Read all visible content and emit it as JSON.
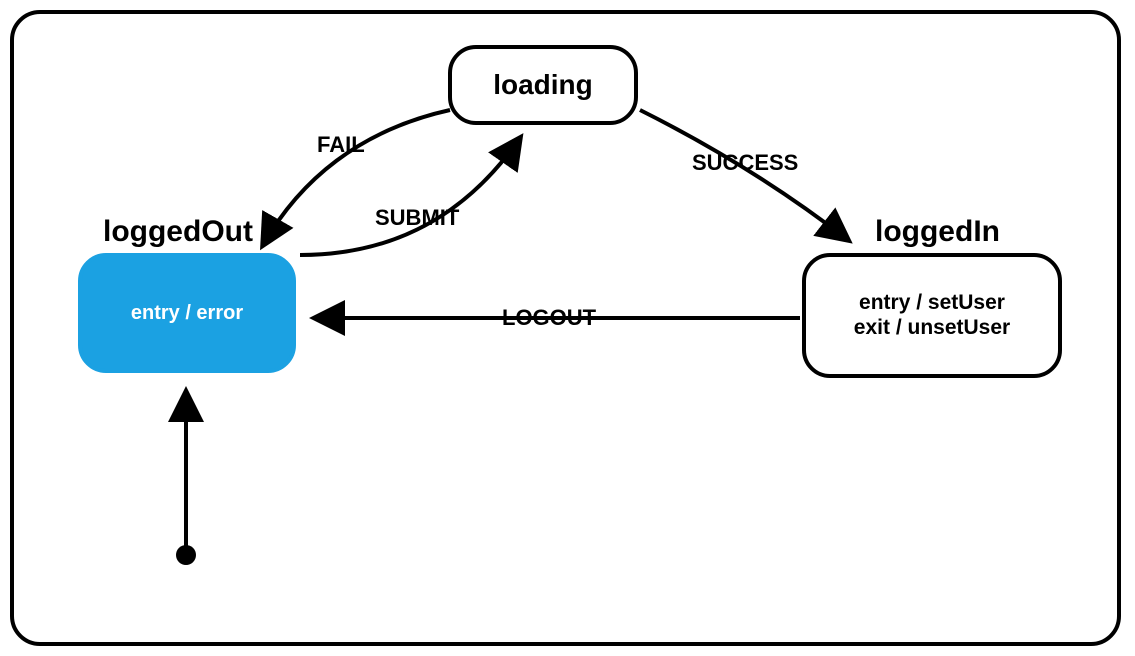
{
  "diagram": {
    "outer_state": "",
    "states": {
      "loggedOut": {
        "title": "loggedOut",
        "body": "entry / error",
        "active": true
      },
      "loading": {
        "title": "loading",
        "body": "",
        "active": false
      },
      "loggedIn": {
        "title": "loggedIn",
        "body_line1": "entry / setUser",
        "body_line2": "exit / unsetUser",
        "active": false
      }
    },
    "transitions": {
      "submit": {
        "label": "SUBMIT",
        "from": "loggedOut",
        "to": "loading"
      },
      "fail": {
        "label": "FAIL",
        "from": "loading",
        "to": "loggedOut"
      },
      "success": {
        "label": "SUCCESS",
        "from": "loading",
        "to": "loggedIn"
      },
      "logout": {
        "label": "LOGOUT",
        "from": "loggedIn",
        "to": "loggedOut"
      }
    },
    "initial_state": "loggedOut"
  }
}
